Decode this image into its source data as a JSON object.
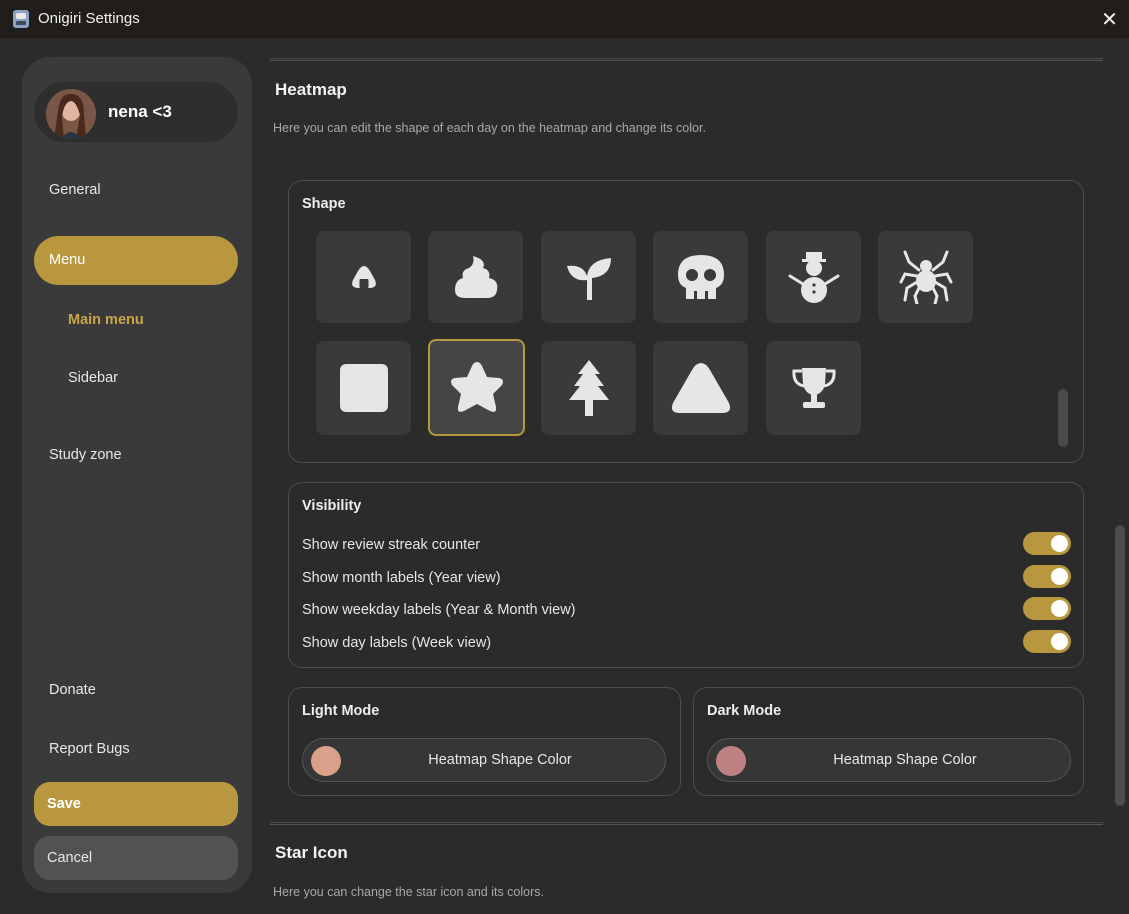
{
  "window": {
    "title": "Onigiri Settings"
  },
  "profile": {
    "name": "nena <3"
  },
  "sidebar": {
    "general": "General",
    "menu": "Menu",
    "main_menu": "Main menu",
    "sidebar": "Sidebar",
    "study_zone": "Study zone",
    "donate": "Donate",
    "report_bugs": "Report Bugs",
    "save": "Save",
    "cancel": "Cancel"
  },
  "heatmap": {
    "title": "Heatmap",
    "description": "Here you can edit the shape of each day on the heatmap and change its color.",
    "shape_title": "Shape",
    "shapes": [
      "onigiri-icon",
      "poop-icon",
      "sprout-icon",
      "skull-icon",
      "snowman-icon",
      "spider-icon",
      "square-icon",
      "star-icon",
      "tree-icon",
      "triangle-icon",
      "trophy-icon"
    ],
    "selected_shape": "star-icon",
    "visibility_title": "Visibility",
    "visibility": [
      {
        "label": "Show review streak counter",
        "on": true
      },
      {
        "label": "Show month labels (Year view)",
        "on": true
      },
      {
        "label": "Show weekday labels (Year & Month view)",
        "on": true
      },
      {
        "label": "Show day labels (Week view)",
        "on": true
      }
    ],
    "light_mode": {
      "title": "Light Mode",
      "button": "Heatmap Shape Color",
      "color": "#d9a08a"
    },
    "dark_mode": {
      "title": "Dark Mode",
      "button": "Heatmap Shape Color",
      "color": "#c08184"
    }
  },
  "star_icon": {
    "title": "Star Icon",
    "description": "Here you can change the star icon and its colors."
  },
  "colors": {
    "accent": "#b8973f",
    "background": "#2b2b2b",
    "sidebar": "#3a3a3a"
  }
}
